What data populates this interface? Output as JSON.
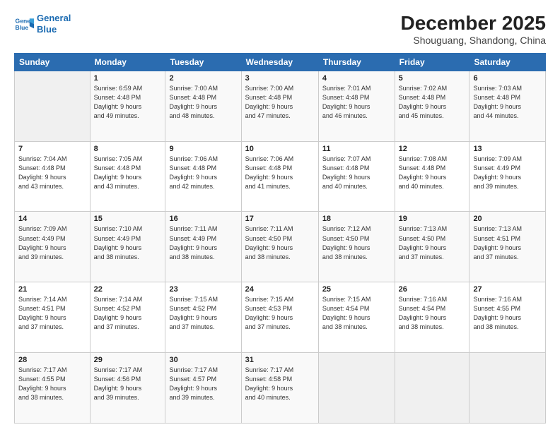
{
  "logo": {
    "line1": "General",
    "line2": "Blue"
  },
  "title": "December 2025",
  "subtitle": "Shouguang, Shandong, China",
  "header_days": [
    "Sunday",
    "Monday",
    "Tuesday",
    "Wednesday",
    "Thursday",
    "Friday",
    "Saturday"
  ],
  "weeks": [
    [
      {
        "day": "",
        "detail": ""
      },
      {
        "day": "1",
        "detail": "Sunrise: 6:59 AM\nSunset: 4:48 PM\nDaylight: 9 hours\nand 49 minutes."
      },
      {
        "day": "2",
        "detail": "Sunrise: 7:00 AM\nSunset: 4:48 PM\nDaylight: 9 hours\nand 48 minutes."
      },
      {
        "day": "3",
        "detail": "Sunrise: 7:00 AM\nSunset: 4:48 PM\nDaylight: 9 hours\nand 47 minutes."
      },
      {
        "day": "4",
        "detail": "Sunrise: 7:01 AM\nSunset: 4:48 PM\nDaylight: 9 hours\nand 46 minutes."
      },
      {
        "day": "5",
        "detail": "Sunrise: 7:02 AM\nSunset: 4:48 PM\nDaylight: 9 hours\nand 45 minutes."
      },
      {
        "day": "6",
        "detail": "Sunrise: 7:03 AM\nSunset: 4:48 PM\nDaylight: 9 hours\nand 44 minutes."
      }
    ],
    [
      {
        "day": "7",
        "detail": "Sunrise: 7:04 AM\nSunset: 4:48 PM\nDaylight: 9 hours\nand 43 minutes."
      },
      {
        "day": "8",
        "detail": "Sunrise: 7:05 AM\nSunset: 4:48 PM\nDaylight: 9 hours\nand 43 minutes."
      },
      {
        "day": "9",
        "detail": "Sunrise: 7:06 AM\nSunset: 4:48 PM\nDaylight: 9 hours\nand 42 minutes."
      },
      {
        "day": "10",
        "detail": "Sunrise: 7:06 AM\nSunset: 4:48 PM\nDaylight: 9 hours\nand 41 minutes."
      },
      {
        "day": "11",
        "detail": "Sunrise: 7:07 AM\nSunset: 4:48 PM\nDaylight: 9 hours\nand 40 minutes."
      },
      {
        "day": "12",
        "detail": "Sunrise: 7:08 AM\nSunset: 4:48 PM\nDaylight: 9 hours\nand 40 minutes."
      },
      {
        "day": "13",
        "detail": "Sunrise: 7:09 AM\nSunset: 4:49 PM\nDaylight: 9 hours\nand 39 minutes."
      }
    ],
    [
      {
        "day": "14",
        "detail": "Sunrise: 7:09 AM\nSunset: 4:49 PM\nDaylight: 9 hours\nand 39 minutes."
      },
      {
        "day": "15",
        "detail": "Sunrise: 7:10 AM\nSunset: 4:49 PM\nDaylight: 9 hours\nand 38 minutes."
      },
      {
        "day": "16",
        "detail": "Sunrise: 7:11 AM\nSunset: 4:49 PM\nDaylight: 9 hours\nand 38 minutes."
      },
      {
        "day": "17",
        "detail": "Sunrise: 7:11 AM\nSunset: 4:50 PM\nDaylight: 9 hours\nand 38 minutes."
      },
      {
        "day": "18",
        "detail": "Sunrise: 7:12 AM\nSunset: 4:50 PM\nDaylight: 9 hours\nand 38 minutes."
      },
      {
        "day": "19",
        "detail": "Sunrise: 7:13 AM\nSunset: 4:50 PM\nDaylight: 9 hours\nand 37 minutes."
      },
      {
        "day": "20",
        "detail": "Sunrise: 7:13 AM\nSunset: 4:51 PM\nDaylight: 9 hours\nand 37 minutes."
      }
    ],
    [
      {
        "day": "21",
        "detail": "Sunrise: 7:14 AM\nSunset: 4:51 PM\nDaylight: 9 hours\nand 37 minutes."
      },
      {
        "day": "22",
        "detail": "Sunrise: 7:14 AM\nSunset: 4:52 PM\nDaylight: 9 hours\nand 37 minutes."
      },
      {
        "day": "23",
        "detail": "Sunrise: 7:15 AM\nSunset: 4:52 PM\nDaylight: 9 hours\nand 37 minutes."
      },
      {
        "day": "24",
        "detail": "Sunrise: 7:15 AM\nSunset: 4:53 PM\nDaylight: 9 hours\nand 37 minutes."
      },
      {
        "day": "25",
        "detail": "Sunrise: 7:15 AM\nSunset: 4:54 PM\nDaylight: 9 hours\nand 38 minutes."
      },
      {
        "day": "26",
        "detail": "Sunrise: 7:16 AM\nSunset: 4:54 PM\nDaylight: 9 hours\nand 38 minutes."
      },
      {
        "day": "27",
        "detail": "Sunrise: 7:16 AM\nSunset: 4:55 PM\nDaylight: 9 hours\nand 38 minutes."
      }
    ],
    [
      {
        "day": "28",
        "detail": "Sunrise: 7:17 AM\nSunset: 4:55 PM\nDaylight: 9 hours\nand 38 minutes."
      },
      {
        "day": "29",
        "detail": "Sunrise: 7:17 AM\nSunset: 4:56 PM\nDaylight: 9 hours\nand 39 minutes."
      },
      {
        "day": "30",
        "detail": "Sunrise: 7:17 AM\nSunset: 4:57 PM\nDaylight: 9 hours\nand 39 minutes."
      },
      {
        "day": "31",
        "detail": "Sunrise: 7:17 AM\nSunset: 4:58 PM\nDaylight: 9 hours\nand 40 minutes."
      },
      {
        "day": "",
        "detail": ""
      },
      {
        "day": "",
        "detail": ""
      },
      {
        "day": "",
        "detail": ""
      }
    ]
  ]
}
